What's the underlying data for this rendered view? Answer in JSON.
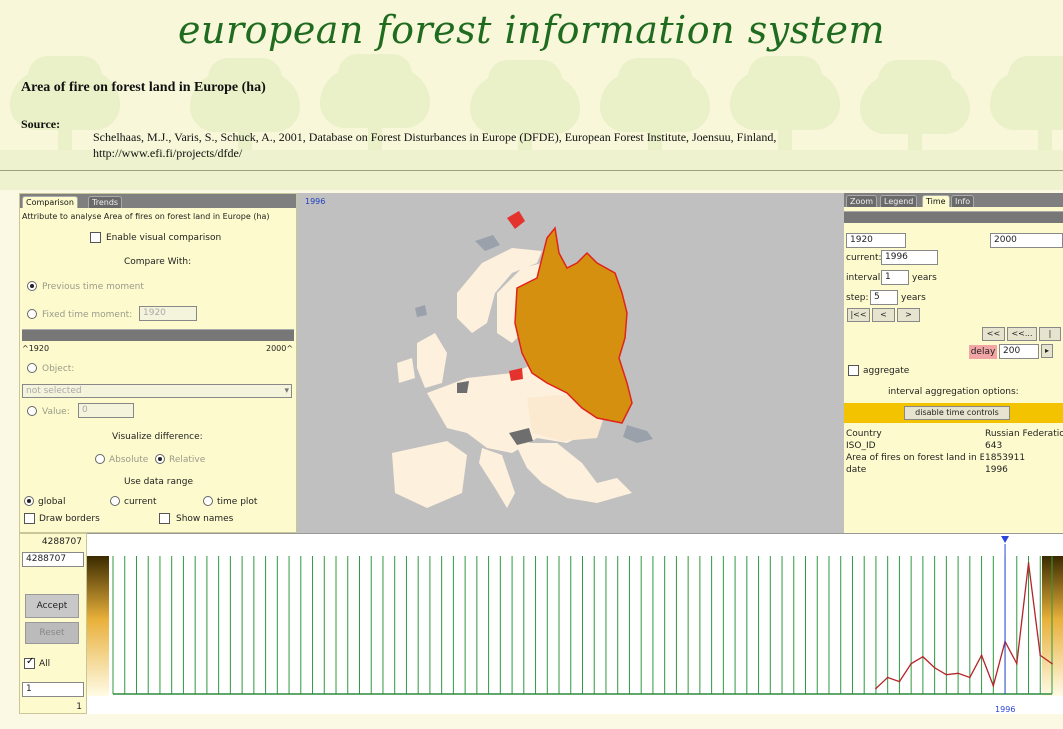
{
  "header": {
    "site_title": "european forest information system",
    "page_title": "Area of fire on forest land in Europe (ha)",
    "source_label": "Source:",
    "source_citation": "Schelhaas, M.J., Varis, S., Schuck, A., 2001, Database on Forest Disturbances in Europe (DFDE), European Forest Institute, Joensuu, Finland,",
    "source_url": "http://www.efi.fi/projects/dfde/"
  },
  "left_panel": {
    "tabs": [
      "Comparison",
      "Trends"
    ],
    "description": "Attribute to analyse Area of fires on forest land in Europe (ha)",
    "enable_visual_comparison": "Enable visual comparison",
    "compare_with": "Compare With:",
    "previous_time_moment": "Previous time moment",
    "fixed_time_moment": "Fixed time moment:",
    "fixed_time_value": "1920",
    "slider_min": "^1920",
    "slider_max": "2000^",
    "object_label": "Object:",
    "object_select": "not selected",
    "value_label": "Value:",
    "value_input": "0",
    "visualize_difference": "Visualize difference:",
    "absolute": "Absolute",
    "relative": "Relative",
    "use_data_range": "Use data range",
    "global": "global",
    "current": "current",
    "time_plot": "time plot",
    "draw_borders": "Draw borders",
    "show_names": "Show names"
  },
  "map": {
    "year_label": "1996",
    "colors": {
      "background": "#c0c0c0",
      "highlighted_country": "#d4900e",
      "highlight_border": "#e0241b",
      "country_fill": "#fdf0dc",
      "no_data": "#9aa1ab",
      "dark": "#6e6e6e",
      "red": "#e4322c"
    }
  },
  "right_panel": {
    "tabs": [
      "Zoom",
      "Legend",
      "Time",
      "Info"
    ],
    "start_year": "1920",
    "end_year": "2000",
    "current_label": "current:",
    "current_value": "1996",
    "interval_label": "interval:",
    "interval_value": "1",
    "interval_unit": "years",
    "step_label": "step:",
    "step_value": "5",
    "step_unit": "years",
    "nav_buttons": [
      "|<<",
      "<",
      ">"
    ],
    "play_buttons": [
      "<<",
      "<<...",
      "|"
    ],
    "delay_label": "delay",
    "delay_value": "200",
    "aggregate": "aggregate",
    "interval_aggregation_options": "interval aggregation options:",
    "disable_time_controls": "disable time controls",
    "info_rows": [
      {
        "key": "Country",
        "value": "Russian Federation"
      },
      {
        "key": "ISO_ID",
        "value": "643"
      },
      {
        "key": "Area of fires on forest land in Europe",
        "value": "1853911"
      },
      {
        "key": "date",
        "value": "1996"
      }
    ]
  },
  "time_plot": {
    "max_label": "4288707",
    "max_input": "4288707",
    "accept": "Accept",
    "reset": "Reset",
    "all_label": "All",
    "min_input": "1",
    "min_label": "1",
    "current_year_label": "1996",
    "start_year": 1920,
    "end_year": 2000,
    "colors": {
      "grid": "#2e9a3e",
      "series": "#b3252a",
      "marker": "#2b46d8",
      "baseline": "#2e8b3e",
      "gradient_top": "#3a2a00",
      "gradient_mid": "#e8b03a",
      "gradient_bottom": "#fffbe6"
    },
    "series": [
      {
        "year": 1985,
        "value": 0.04
      },
      {
        "year": 1986,
        "value": 0.12
      },
      {
        "year": 1987,
        "value": 0.09
      },
      {
        "year": 1988,
        "value": 0.22
      },
      {
        "year": 1989,
        "value": 0.27
      },
      {
        "year": 1990,
        "value": 0.19
      },
      {
        "year": 1991,
        "value": 0.14
      },
      {
        "year": 1992,
        "value": 0.15
      },
      {
        "year": 1993,
        "value": 0.12
      },
      {
        "year": 1994,
        "value": 0.28
      },
      {
        "year": 1995,
        "value": 0.06
      },
      {
        "year": 1996,
        "value": 0.38
      },
      {
        "year": 1997,
        "value": 0.22
      },
      {
        "year": 1998,
        "value": 0.95
      },
      {
        "year": 1999,
        "value": 0.28
      },
      {
        "year": 2000,
        "value": 0.22
      }
    ]
  }
}
